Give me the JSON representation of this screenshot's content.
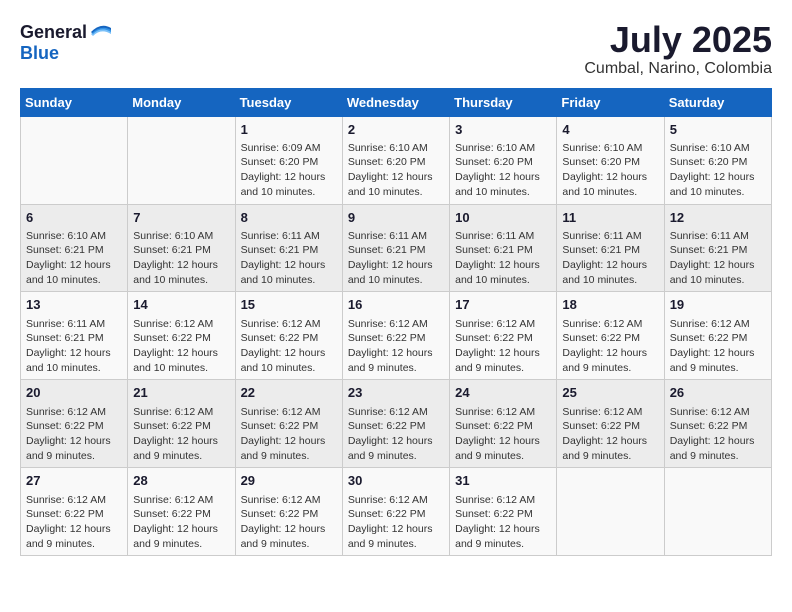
{
  "logo": {
    "text_general": "General",
    "text_blue": "Blue"
  },
  "title": "July 2025",
  "subtitle": "Cumbal, Narino, Colombia",
  "days_of_week": [
    "Sunday",
    "Monday",
    "Tuesday",
    "Wednesday",
    "Thursday",
    "Friday",
    "Saturday"
  ],
  "weeks": [
    [
      {
        "day": "",
        "info": ""
      },
      {
        "day": "",
        "info": ""
      },
      {
        "day": "1",
        "info": "Sunrise: 6:09 AM\nSunset: 6:20 PM\nDaylight: 12 hours and 10 minutes."
      },
      {
        "day": "2",
        "info": "Sunrise: 6:10 AM\nSunset: 6:20 PM\nDaylight: 12 hours and 10 minutes."
      },
      {
        "day": "3",
        "info": "Sunrise: 6:10 AM\nSunset: 6:20 PM\nDaylight: 12 hours and 10 minutes."
      },
      {
        "day": "4",
        "info": "Sunrise: 6:10 AM\nSunset: 6:20 PM\nDaylight: 12 hours and 10 minutes."
      },
      {
        "day": "5",
        "info": "Sunrise: 6:10 AM\nSunset: 6:20 PM\nDaylight: 12 hours and 10 minutes."
      }
    ],
    [
      {
        "day": "6",
        "info": "Sunrise: 6:10 AM\nSunset: 6:21 PM\nDaylight: 12 hours and 10 minutes."
      },
      {
        "day": "7",
        "info": "Sunrise: 6:10 AM\nSunset: 6:21 PM\nDaylight: 12 hours and 10 minutes."
      },
      {
        "day": "8",
        "info": "Sunrise: 6:11 AM\nSunset: 6:21 PM\nDaylight: 12 hours and 10 minutes."
      },
      {
        "day": "9",
        "info": "Sunrise: 6:11 AM\nSunset: 6:21 PM\nDaylight: 12 hours and 10 minutes."
      },
      {
        "day": "10",
        "info": "Sunrise: 6:11 AM\nSunset: 6:21 PM\nDaylight: 12 hours and 10 minutes."
      },
      {
        "day": "11",
        "info": "Sunrise: 6:11 AM\nSunset: 6:21 PM\nDaylight: 12 hours and 10 minutes."
      },
      {
        "day": "12",
        "info": "Sunrise: 6:11 AM\nSunset: 6:21 PM\nDaylight: 12 hours and 10 minutes."
      }
    ],
    [
      {
        "day": "13",
        "info": "Sunrise: 6:11 AM\nSunset: 6:21 PM\nDaylight: 12 hours and 10 minutes."
      },
      {
        "day": "14",
        "info": "Sunrise: 6:12 AM\nSunset: 6:22 PM\nDaylight: 12 hours and 10 minutes."
      },
      {
        "day": "15",
        "info": "Sunrise: 6:12 AM\nSunset: 6:22 PM\nDaylight: 12 hours and 10 minutes."
      },
      {
        "day": "16",
        "info": "Sunrise: 6:12 AM\nSunset: 6:22 PM\nDaylight: 12 hours and 9 minutes."
      },
      {
        "day": "17",
        "info": "Sunrise: 6:12 AM\nSunset: 6:22 PM\nDaylight: 12 hours and 9 minutes."
      },
      {
        "day": "18",
        "info": "Sunrise: 6:12 AM\nSunset: 6:22 PM\nDaylight: 12 hours and 9 minutes."
      },
      {
        "day": "19",
        "info": "Sunrise: 6:12 AM\nSunset: 6:22 PM\nDaylight: 12 hours and 9 minutes."
      }
    ],
    [
      {
        "day": "20",
        "info": "Sunrise: 6:12 AM\nSunset: 6:22 PM\nDaylight: 12 hours and 9 minutes."
      },
      {
        "day": "21",
        "info": "Sunrise: 6:12 AM\nSunset: 6:22 PM\nDaylight: 12 hours and 9 minutes."
      },
      {
        "day": "22",
        "info": "Sunrise: 6:12 AM\nSunset: 6:22 PM\nDaylight: 12 hours and 9 minutes."
      },
      {
        "day": "23",
        "info": "Sunrise: 6:12 AM\nSunset: 6:22 PM\nDaylight: 12 hours and 9 minutes."
      },
      {
        "day": "24",
        "info": "Sunrise: 6:12 AM\nSunset: 6:22 PM\nDaylight: 12 hours and 9 minutes."
      },
      {
        "day": "25",
        "info": "Sunrise: 6:12 AM\nSunset: 6:22 PM\nDaylight: 12 hours and 9 minutes."
      },
      {
        "day": "26",
        "info": "Sunrise: 6:12 AM\nSunset: 6:22 PM\nDaylight: 12 hours and 9 minutes."
      }
    ],
    [
      {
        "day": "27",
        "info": "Sunrise: 6:12 AM\nSunset: 6:22 PM\nDaylight: 12 hours and 9 minutes."
      },
      {
        "day": "28",
        "info": "Sunrise: 6:12 AM\nSunset: 6:22 PM\nDaylight: 12 hours and 9 minutes."
      },
      {
        "day": "29",
        "info": "Sunrise: 6:12 AM\nSunset: 6:22 PM\nDaylight: 12 hours and 9 minutes."
      },
      {
        "day": "30",
        "info": "Sunrise: 6:12 AM\nSunset: 6:22 PM\nDaylight: 12 hours and 9 minutes."
      },
      {
        "day": "31",
        "info": "Sunrise: 6:12 AM\nSunset: 6:22 PM\nDaylight: 12 hours and 9 minutes."
      },
      {
        "day": "",
        "info": ""
      },
      {
        "day": "",
        "info": ""
      }
    ]
  ]
}
